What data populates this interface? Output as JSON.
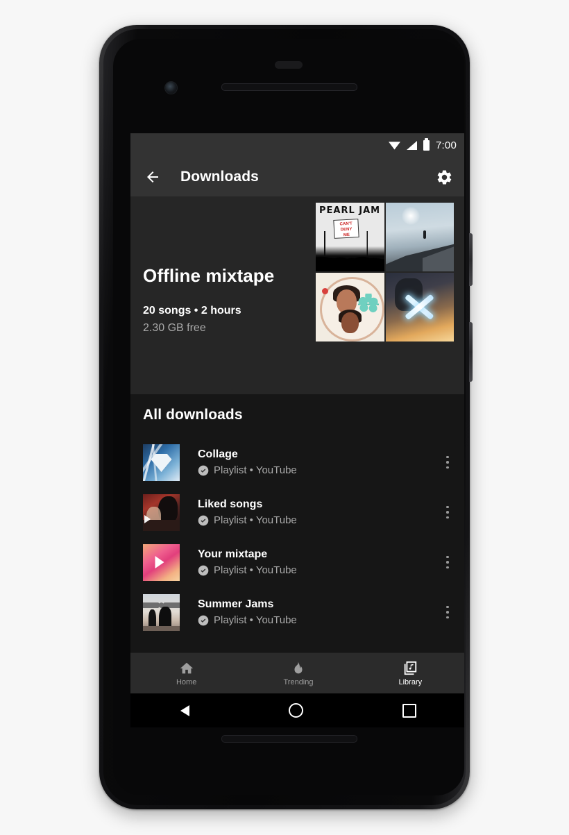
{
  "statusbar": {
    "time": "7:00",
    "icons": [
      "wifi-icon",
      "signal-icon",
      "battery-icon"
    ]
  },
  "appbar": {
    "back_icon": "back-arrow-icon",
    "title": "Downloads",
    "settings_icon": "gear-icon"
  },
  "hero": {
    "title": "Offline mixtape",
    "stats": "20 songs • 2 hours",
    "storage": "2.30 GB free",
    "artwork": [
      {
        "name": "pearl-jam-cant-deny-me",
        "title": "PEARL JAM",
        "sign_line1": "CAN'T",
        "sign_line2": "DENY",
        "sign_line3": "ME"
      },
      {
        "name": "rooftop-sky-cover"
      },
      {
        "name": "portrait-illustration-cover"
      },
      {
        "name": "alan-walker-logo-cover"
      }
    ]
  },
  "downloads": {
    "section_title": "All downloads",
    "items": [
      {
        "title": "Collage",
        "meta": "Playlist • YouTube",
        "badge": "downloaded-check-icon",
        "thumb": "collage-diamond-thumb"
      },
      {
        "title": "Liked songs",
        "meta": "Playlist • YouTube",
        "badge": "downloaded-check-icon",
        "thumb": "liked-songs-thumb"
      },
      {
        "title": "Your mixtape",
        "meta": "Playlist • YouTube",
        "badge": "downloaded-check-icon",
        "thumb": "your-mixtape-thumb"
      },
      {
        "title": "Summer Jams",
        "meta": "Playlist • YouTube",
        "badge": "downloaded-check-icon",
        "thumb": "summer-jams-thumb"
      }
    ],
    "overflow_icon": "more-vertical-icon"
  },
  "bottomnav": {
    "items": [
      {
        "label": "Home",
        "icon": "home-icon",
        "active": false
      },
      {
        "label": "Trending",
        "icon": "flame-icon",
        "active": false
      },
      {
        "label": "Library",
        "icon": "library-icon",
        "active": true
      }
    ]
  },
  "androidnav": {
    "back": "back-triangle-icon",
    "home": "home-circle-icon",
    "recents": "recents-square-icon"
  },
  "colors": {
    "appbar_bg": "#333333",
    "hero_bg": "#262626",
    "list_bg": "#161616",
    "nav_bg": "#2b2b2b",
    "accent_text": "#ffffff",
    "secondary_text": "#aaaaaa"
  }
}
